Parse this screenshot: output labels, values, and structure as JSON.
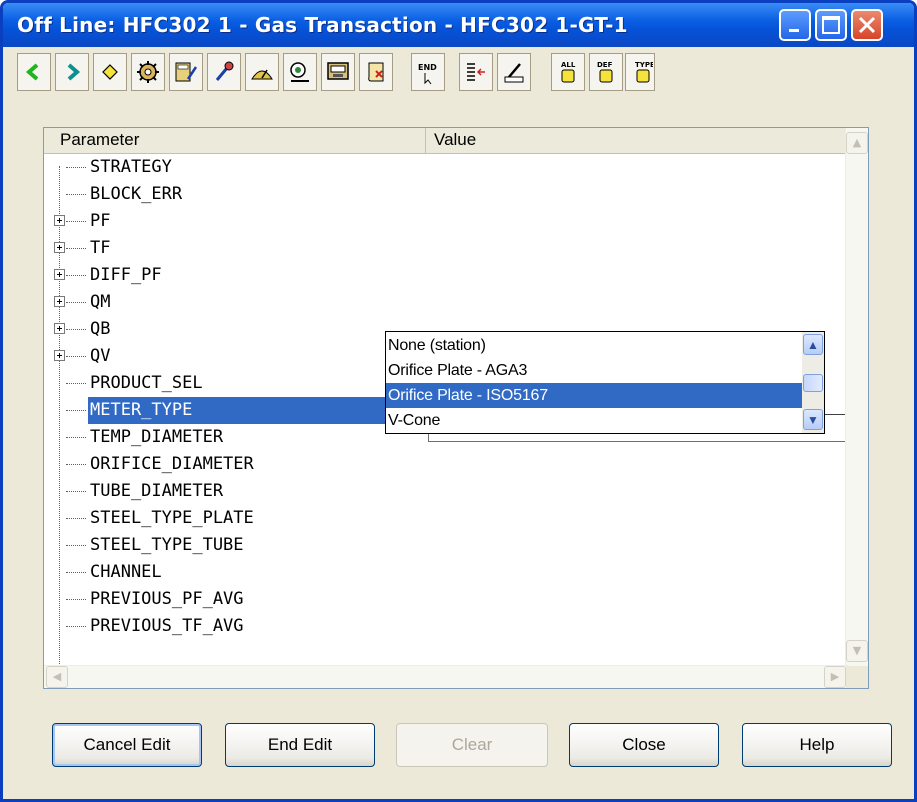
{
  "window": {
    "title": "Off Line: HFC302 1 - Gas Transaction - HFC302 1-GT-1"
  },
  "toolbar": {
    "buttons": [
      {
        "icon": "previous-green-arrow-icon"
      },
      {
        "icon": "next-arrow-icon"
      },
      {
        "icon": "diamond-icon"
      },
      {
        "icon": "gears-icon"
      },
      {
        "icon": "calculator-edit-icon"
      },
      {
        "icon": "probe-icon"
      },
      {
        "icon": "gauge-icon"
      },
      {
        "icon": "satellite-dish-icon"
      },
      {
        "icon": "monitor-icon"
      },
      {
        "icon": "scroll-icon"
      },
      {
        "icon": "end-edit-icon",
        "label": "END"
      },
      {
        "icon": "list-arrow-icon"
      },
      {
        "icon": "write-pen-icon"
      },
      {
        "icon": "all-block-icon",
        "label": "ALL"
      },
      {
        "icon": "def-block-icon",
        "label": "DEF"
      },
      {
        "icon": "type-block-icon",
        "label": "TYPE"
      }
    ]
  },
  "grid": {
    "columns": {
      "parameter": "Parameter",
      "value": "Value"
    },
    "rows": [
      {
        "label": "STRATEGY",
        "expandable": false
      },
      {
        "label": "BLOCK_ERR",
        "expandable": false
      },
      {
        "label": "PF",
        "expandable": true
      },
      {
        "label": "TF",
        "expandable": true
      },
      {
        "label": "DIFF_PF",
        "expandable": true
      },
      {
        "label": "QM",
        "expandable": true
      },
      {
        "label": "QB",
        "expandable": true
      },
      {
        "label": "QV",
        "expandable": true
      },
      {
        "label": "PRODUCT_SEL",
        "expandable": false
      },
      {
        "label": "METER_TYPE",
        "expandable": false,
        "selected": true
      },
      {
        "label": "TEMP_DIAMETER",
        "expandable": false
      },
      {
        "label": "ORIFICE_DIAMETER",
        "expandable": false
      },
      {
        "label": "TUBE_DIAMETER",
        "expandable": false
      },
      {
        "label": "STEEL_TYPE_PLATE",
        "expandable": false
      },
      {
        "label": "STEEL_TYPE_TUBE",
        "expandable": false
      },
      {
        "label": "CHANNEL",
        "expandable": false
      },
      {
        "label": "PREVIOUS_PF_AVG",
        "expandable": false
      },
      {
        "label": "PREVIOUS_TF_AVG",
        "expandable": false
      }
    ],
    "edit_value": ""
  },
  "dropdown": {
    "options": [
      "None (station)",
      "Orifice Plate - AGA3",
      "Orifice Plate - ISO5167",
      "V-Cone"
    ],
    "selected_index": 2
  },
  "buttons": {
    "cancel_edit": "Cancel Edit",
    "end_edit": "End Edit",
    "clear": "Clear",
    "close": "Close",
    "help": "Help"
  },
  "colors": {
    "title_bar": "#0a5fe3",
    "selection": "#316ac5",
    "close_button": "#d6452a"
  }
}
